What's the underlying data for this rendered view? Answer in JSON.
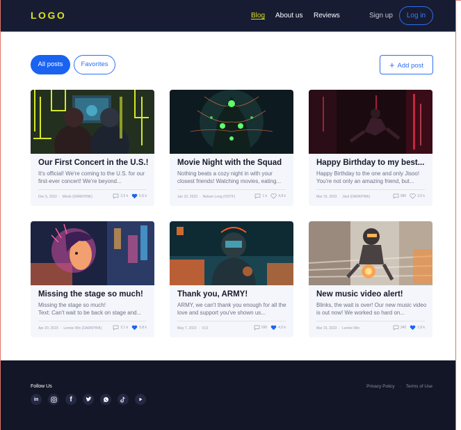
{
  "header": {
    "logo": "LOGO",
    "nav": [
      "Blog",
      "About us",
      "Reviews"
    ],
    "signup": "Sign up",
    "login": "Log in"
  },
  "filters": {
    "all": "All posts",
    "favorites": "Favorites",
    "add_post": "Add post"
  },
  "posts": [
    {
      "title": "Our First Concert in the U.S.!",
      "excerpt": "It's official! We're coming to the U.S. for our first-ever concert! We're beyond...",
      "date": "Dec 5, 2022",
      "author": "Minsk (DARKPINK)",
      "comments": "2,5 k",
      "likes": "5,6 k",
      "liked": true
    },
    {
      "title": "Movie Night with the Squad",
      "excerpt": "Nothing beats a cozy night in with your closest friends! Watching movies, eating...",
      "date": "Jan 10, 2023",
      "author": "Nelson Long (OOTF)",
      "comments": "1 k",
      "likes": "4,8 k",
      "liked": false
    },
    {
      "title": "Happy Birthday to my best...",
      "excerpt": "Happy Birthday to the one and only Jisoo! You're not only an amazing friend, but...",
      "date": "Mar 15, 2023",
      "author": "Jisol (DARKPINK)",
      "comments": "980",
      "likes": "3,5 k",
      "liked": false
    },
    {
      "title": "Missing the stage so much!",
      "excerpt": " Missing the stage so much!\nText: Can't wait to be back on stage and...",
      "date": "Apr 20, 2023",
      "author": "Lennie Win (DARKPINK)",
      "comments": "2,1 k",
      "likes": "9,8 k",
      "liked": true
    },
    {
      "title": "Thank you, ARMY!",
      "excerpt": "ARMY, we can't thank you enough for all the love and support you've shown us...",
      "date": "May 7, 2023",
      "author": "V13",
      "comments": "590",
      "likes": "4,5 k",
      "liked": true
    },
    {
      "title": "New music video alert!",
      "excerpt": "Blinks, the wait is over! Our new music video is out now! We worked so hard on...",
      "date": "Mar 15, 2023",
      "author": "Lennie Win",
      "comments": "340",
      "likes": "2,8 k",
      "liked": true
    }
  ],
  "footer": {
    "follow_label": "Follow Us",
    "socials": [
      "linkedin-icon",
      "instagram-icon",
      "facebook-icon",
      "twitter-icon",
      "whatsapp-icon",
      "tiktok-icon",
      "youtube-icon"
    ],
    "privacy": "Privacy Policy",
    "terms": "Terms of Use"
  },
  "colors": {
    "header_bg": "#171c33",
    "logo": "#d9e021",
    "accent": "#1a63f0",
    "footer_bg": "#131626"
  }
}
